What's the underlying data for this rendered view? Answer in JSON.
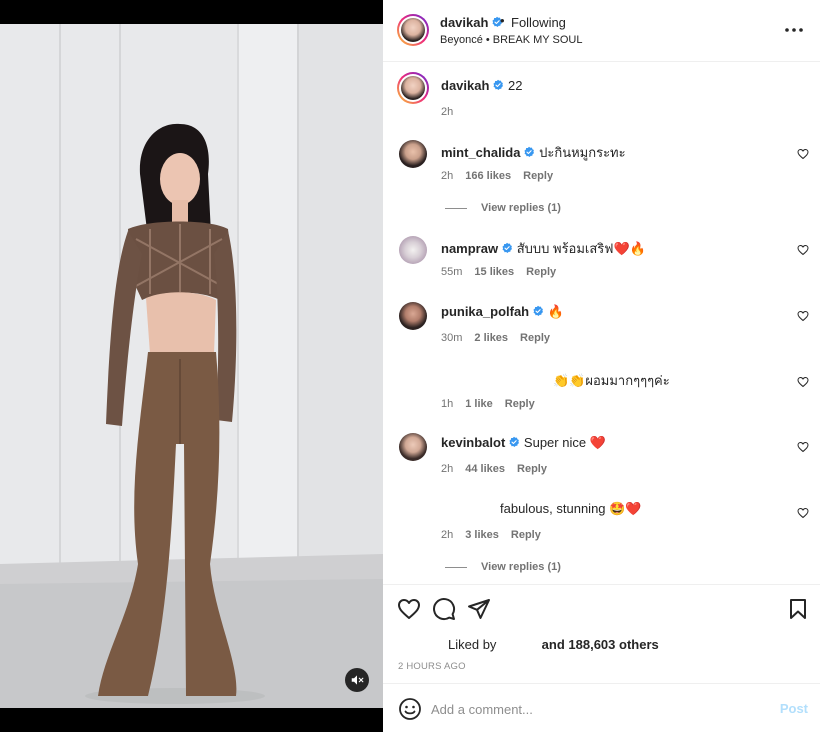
{
  "post": {
    "author": "davikah",
    "dot": "•",
    "follow_status": "Following",
    "music": "Beyoncé • BREAK MY SOUL",
    "more_icon": "more-horizontal-icon"
  },
  "caption": {
    "username": "davikah",
    "text": "22",
    "time": "2h"
  },
  "comments": [
    {
      "username": "mint_chalida",
      "text": "ปะกินหมูกระทะ",
      "time": "2h",
      "likes": "166 likes",
      "reply": "Reply",
      "view_replies": "View replies (1)"
    },
    {
      "username": "nampraw",
      "text": "สับบบ พร้อมเสริฟ❤️🔥",
      "time": "55m",
      "likes": "15 likes",
      "reply": "Reply"
    },
    {
      "username": "punika_polfah",
      "text": "🔥",
      "time": "30m",
      "likes": "2 likes",
      "reply": "Reply"
    },
    {
      "username": "",
      "text": "👏👏ผอมมากๆๆๆค่ะ",
      "time": "1h",
      "likes": "1 like",
      "reply": "Reply"
    },
    {
      "username": "kevinbalot",
      "text": "Super nice ❤️",
      "time": "2h",
      "likes": "44 likes",
      "reply": "Reply"
    },
    {
      "username": "",
      "text": "fabulous, stunning 🤩❤️",
      "time": "2h",
      "likes": "3 likes",
      "reply": "Reply",
      "view_replies": "View replies (1)"
    }
  ],
  "actions": {
    "liked_by_prefix": "Liked by",
    "liked_by_suffix": "and 188,603 others",
    "timestamp": "2 HOURS AGO"
  },
  "comment_box": {
    "placeholder": "Add a comment...",
    "post_label": "Post"
  },
  "colors": {
    "verified_blue": "#3897f0",
    "heart_red": "#ed4956",
    "post_button_disabled": "#b2dffc",
    "pants_brown": "#7a5a44"
  }
}
